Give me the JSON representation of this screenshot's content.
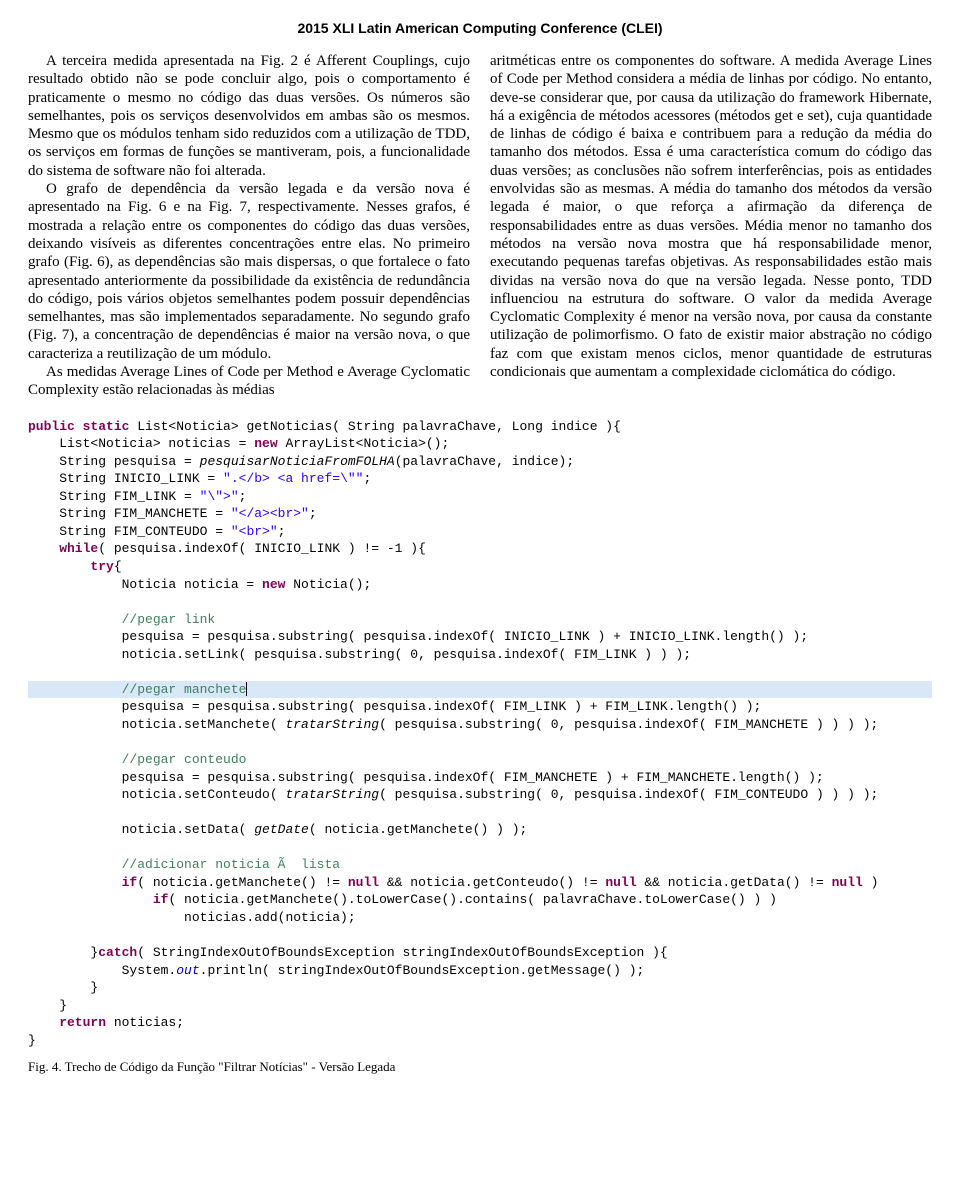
{
  "header": "2015 XLI Latin American Computing Conference (CLEI)",
  "col1_p1": "A terceira medida apresentada na Fig. 2 é Afferent Couplings, cujo resultado obtido não se pode concluir algo, pois o comportamento é praticamente o mesmo no código das duas versões. Os números são semelhantes, pois os serviços desenvolvidos em ambas são os mesmos. Mesmo que os módulos tenham sido reduzidos com a utilização de TDD, os serviços em formas de funções se mantiveram, pois, a funcionalidade do sistema de software não foi alterada.",
  "col1_p2": "O grafo de dependência da versão legada e da versão nova é apresentado na Fig. 6 e na Fig. 7, respectivamente. Nesses grafos, é mostrada a relação entre os componentes do código das duas versões, deixando visíveis as diferentes concentrações entre elas. No primeiro grafo (Fig. 6), as dependências são mais dispersas, o que fortalece o fato apresentado anteriormente da possibilidade da existência de redundância do código, pois vários objetos semelhantes podem possuir dependências semelhantes, mas são implementados separadamente. No segundo grafo (Fig. 7), a concentração de dependências é maior na versão nova, o que caracteriza a reutilização de um módulo.",
  "col1_p3": "As medidas Average Lines of Code per Method e Average Cyclomatic Complexity estão relacionadas às médias",
  "col2_p1": "aritméticas entre os componentes do software. A medida Average Lines of Code per Method considera a média de linhas por código. No entanto, deve-se considerar que, por causa da utilização do framework Hibernate, há a exigência de métodos acessores (métodos get e set), cuja quantidade de linhas de código é baixa e contribuem para a redução da média do tamanho dos métodos. Essa é uma característica comum do código das duas versões; as conclusões não sofrem interferências, pois as entidades envolvidas são as mesmas. A média do tamanho dos métodos da versão legada é maior, o que reforça a afirmação da diferença de responsabilidades entre as duas versões. Média menor no tamanho dos métodos na versão nova mostra que há responsabilidade menor, executando pequenas tarefas objetivas. As responsabilidades estão mais dividas na versão nova do que na versão legada. Nesse ponto, TDD influenciou na estrutura do software. O valor da medida Average Cyclomatic Complexity é menor na versão nova, por causa da constante utilização de polimorfismo. O fato de existir maior abstração no código faz com que existam menos ciclos, menor quantidade de estruturas condicionais que aumentam a complexidade ciclomática do código.",
  "code": {
    "l1a": "public static",
    "l1b": " List<Noticia> getNoticias( String palavraChave, Long indice ){",
    "l2a": "    List<Noticia> noticias = ",
    "l2b": "new",
    "l2c": " ArrayList<Noticia>();",
    "l3a": "    String pesquisa = ",
    "l3b": "pesquisarNoticiaFromFOLHA",
    "l3c": "(palavraChave, indice);",
    "l4a": "    String INICIO_LINK = ",
    "l4b": "\".</b> <a href=\\\"\"",
    "l4c": ";",
    "l5a": "    String FIM_LINK = ",
    "l5b": "\"\\\">\"",
    "l5c": ";",
    "l6a": "    String FIM_MANCHETE = ",
    "l6b": "\"</a><br>\"",
    "l6c": ";",
    "l7a": "    String FIM_CONTEUDO = ",
    "l7b": "\"<br>\"",
    "l7c": ";",
    "l8a": "    while",
    "l8b": "( pesquisa.indexOf( INICIO_LINK ) != -1 ){",
    "l9a": "        try",
    "l9b": "{",
    "l10": "            Noticia noticia = ",
    "l10b": "new",
    "l10c": " Noticia();",
    "blank1": "",
    "l11": "            //pegar link",
    "l12": "            pesquisa = pesquisa.substring( pesquisa.indexOf( INICIO_LINK ) + INICIO_LINK.length() );",
    "l13": "            noticia.setLink( pesquisa.substring( 0, pesquisa.indexOf( FIM_LINK ) ) );",
    "blank2": "",
    "l14": "            //pegar manchete",
    "l15": "            pesquisa = pesquisa.substring( pesquisa.indexOf( FIM_LINK ) + FIM_LINK.length() );",
    "l16a": "            noticia.setManchete( ",
    "l16b": "tratarString",
    "l16c": "( pesquisa.substring( 0, pesquisa.indexOf( FIM_MANCHETE ) ) ) );",
    "blank3": "",
    "l17": "            //pegar conteudo",
    "l18": "            pesquisa = pesquisa.substring( pesquisa.indexOf( FIM_MANCHETE ) + FIM_MANCHETE.length() );",
    "l19a": "            noticia.setConteudo( ",
    "l19b": "tratarString",
    "l19c": "( pesquisa.substring( 0, pesquisa.indexOf( FIM_CONTEUDO ) ) ) );",
    "blank4": "",
    "l20a": "            noticia.setData( ",
    "l20b": "getDate",
    "l20c": "( noticia.getManchete() ) );",
    "blank5": "",
    "l21": "            //adicionar noticia Ã  lista",
    "l22a": "            if",
    "l22b": "( noticia.getManchete() != ",
    "l22c": "null",
    "l22d": " && noticia.getConteudo() != ",
    "l22e": "null",
    "l22f": " && noticia.getData() != ",
    "l22g": "null",
    "l22h": " )",
    "l23a": "                if",
    "l23b": "( noticia.getManchete().toLowerCase().contains( palavraChave.toLowerCase() ) )",
    "l24": "                    noticias.add(noticia);",
    "blank6": "",
    "l25a": "        }",
    "l25b": "catch",
    "l25c": "( StringIndexOutOfBoundsException stringIndexOutOfBoundsException ){",
    "l26a": "            System.",
    "l26b": "out",
    "l26c": ".println( stringIndexOutOfBoundsException.getMessage() );",
    "l27": "        }",
    "l28": "    }",
    "l29a": "    return",
    "l29b": " noticias;",
    "l30": "}"
  },
  "caption": "Fig. 4.  Trecho de Código da Função \"Filtrar Notícias\" - Versão Legada"
}
